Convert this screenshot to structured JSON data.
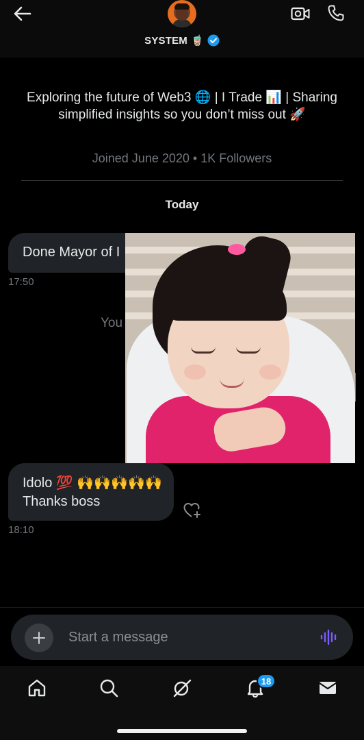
{
  "header": {
    "username": "SYSTEM",
    "name_emoji": "🧋",
    "verified": true
  },
  "profile": {
    "bio": "Exploring the future of Web3 🌐 | I Trade 📊 | Sharing simplified insights so you don’t miss out 🚀",
    "joined": "Joined June 2020 • 1K Followers"
  },
  "conversation": {
    "day_label": "Today",
    "messages": [
      {
        "text": "Done Mayor of I",
        "time": "17:50"
      },
      {
        "text": "You",
        "time": ""
      },
      {
        "text_line1": "Idolo 💯 🙌🙌🙌🙌🙌",
        "text_line2": "Thanks boss",
        "time": "18:10"
      }
    ]
  },
  "composer": {
    "placeholder": "Start a message"
  },
  "nav": {
    "notifications_badge": "18"
  },
  "colors": {
    "accent": "#1d9bf0",
    "voice": "#7c5cff",
    "bubble": "#202327",
    "muted_text": "#71767b"
  },
  "icons": [
    "back-arrow-icon",
    "video-camera-icon",
    "phone-icon",
    "verified-badge-icon",
    "plus-icon",
    "voice-wave-icon",
    "heart-plus-icon",
    "home-icon",
    "search-icon",
    "grok-icon",
    "bell-icon",
    "mail-icon"
  ]
}
